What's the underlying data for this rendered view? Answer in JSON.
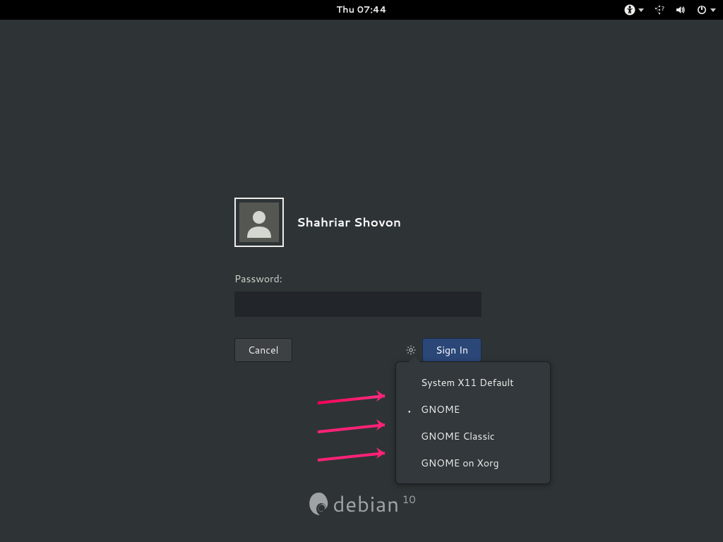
{
  "topbar": {
    "clock": "Thu 07:44"
  },
  "login": {
    "username": "Shahriar Shovon",
    "password_label": "Password:",
    "password_value": "",
    "cancel_label": "Cancel",
    "signin_label": "Sign In"
  },
  "session_menu": {
    "items": [
      {
        "label": "System X11 Default",
        "selected": false
      },
      {
        "label": "GNOME",
        "selected": true
      },
      {
        "label": "GNOME Classic",
        "selected": false
      },
      {
        "label": "GNOME on Xorg",
        "selected": false
      }
    ]
  },
  "branding": {
    "name": "debian",
    "version": "10"
  }
}
